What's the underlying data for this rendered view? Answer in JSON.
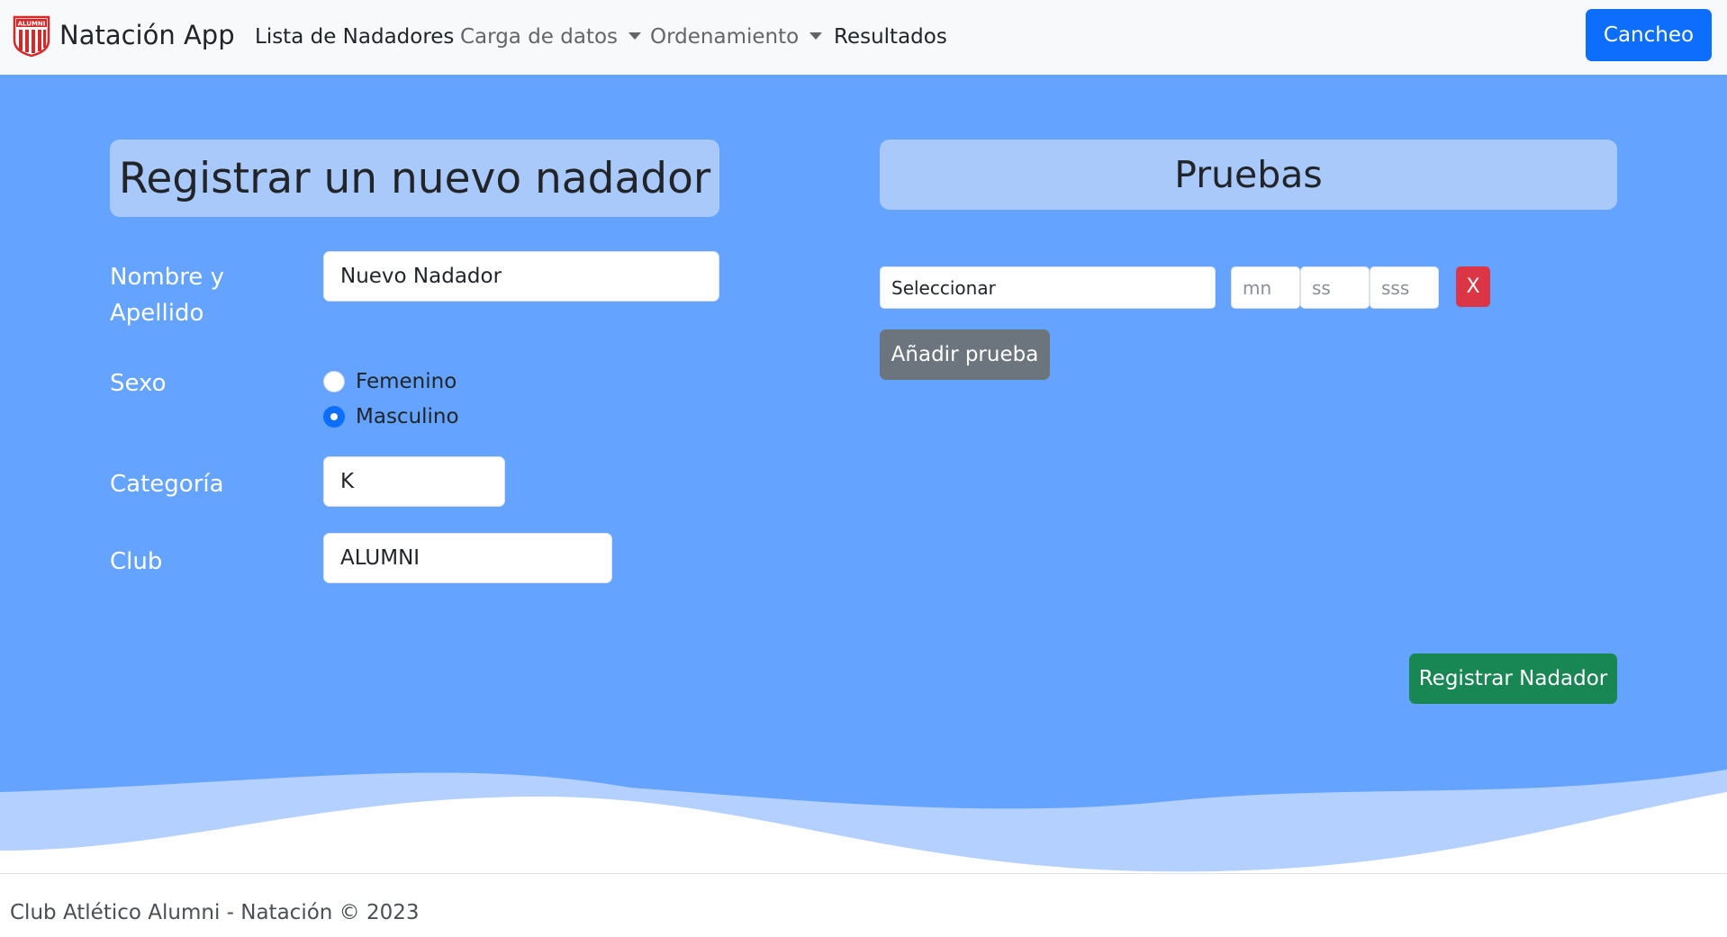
{
  "navbar": {
    "brand": "Natación App",
    "logo_text": "ALUMNI",
    "items": [
      {
        "label": "Lista de Nadadores",
        "dropdown": false
      },
      {
        "label": "Carga de datos",
        "dropdown": true
      },
      {
        "label": "Ordenamiento",
        "dropdown": true
      },
      {
        "label": "Resultados",
        "dropdown": false
      }
    ],
    "user_button": "Cancheo"
  },
  "form": {
    "title": "Registrar un nuevo nadador",
    "name_label_1": "Nombre y",
    "name_label_2": "Apellido",
    "name_value": "Nuevo Nadador",
    "sex_label": "Sexo",
    "sex_options": [
      {
        "label": "Femenino",
        "checked": false
      },
      {
        "label": "Masculino",
        "checked": true
      }
    ],
    "category_label": "Categoría",
    "category_value": "K",
    "club_label": "Club",
    "club_value": "ALUMNI"
  },
  "tests": {
    "title": "Pruebas",
    "select_value": "Seleccionar",
    "min_placeholder": "mn",
    "sec_placeholder": "ss",
    "ms_placeholder": "sss",
    "remove_label": "X",
    "add_label": "Añadir prueba"
  },
  "register_button": "Registrar Nadador",
  "footer": {
    "text": "Club Atlético Alumni - Natación © 2023"
  },
  "colors": {
    "background": "#64a3ff",
    "title_box": "#a9c9fa",
    "primary": "#0d6efd",
    "success": "#198754",
    "danger": "#dc3545",
    "secondary": "#6c757d"
  }
}
